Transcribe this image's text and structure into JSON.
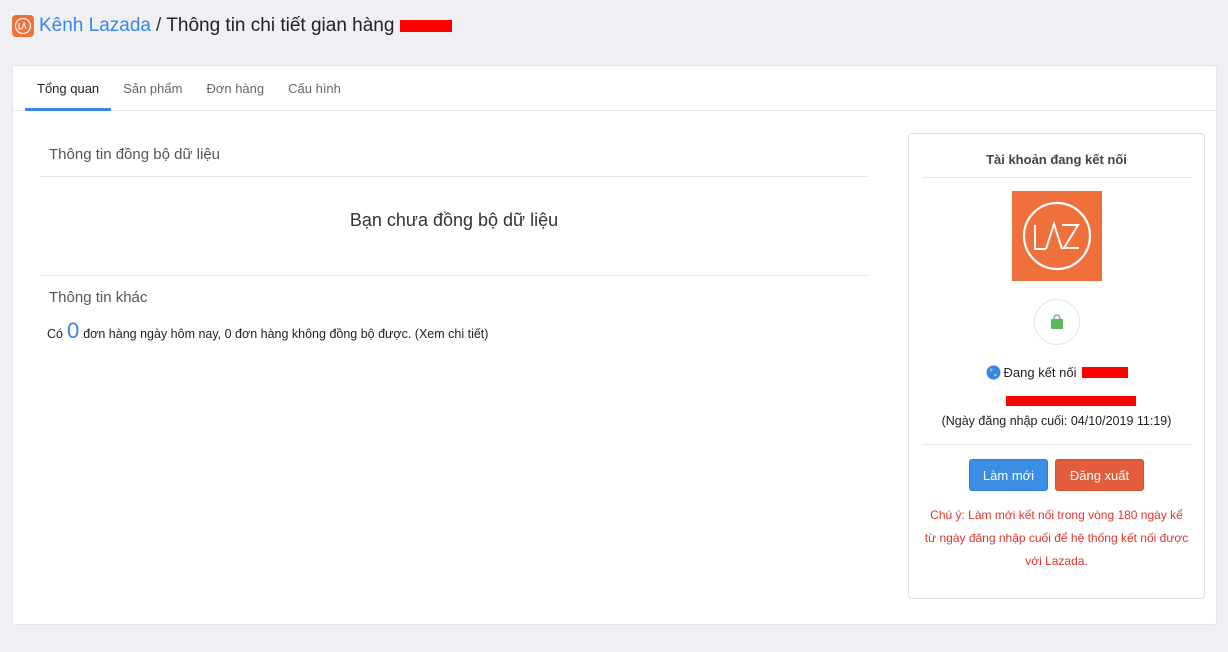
{
  "header": {
    "breadcrumb_link": "Kênh Lazada",
    "separator": "/",
    "title": "Thông tin chi tiết gian hàng"
  },
  "tabs": [
    {
      "label": "Tổng quan",
      "active": true
    },
    {
      "label": "Sản phẩm",
      "active": false
    },
    {
      "label": "Đơn hàng",
      "active": false
    },
    {
      "label": "Cấu hình",
      "active": false
    }
  ],
  "sync": {
    "section_title": "Thông tin đồng bộ dữ liệu",
    "message": "Bạn chưa đồng bộ dữ liệu"
  },
  "other": {
    "section_title": "Thông tin khác",
    "prefix": "Có",
    "orders_today": "0",
    "suffix": "đơn hàng ngày hôm nay, 0 đơn hàng không đồng bộ được. (Xem chi tiết)"
  },
  "account": {
    "title": "Tài khoản đang kết nối",
    "logo_text": "LAZ",
    "connected_label": "Đang kết nối",
    "last_login": "(Ngày đăng nhập cuối: 04/10/2019 11:19)",
    "refresh_button": "Làm mới",
    "logout_button": "Đăng xuất",
    "note": "Chú ý: Làm mới kết nối trong vòng 180 ngày kể từ ngày đăng nhập cuối để hệ thống kết nối được với Lazada."
  },
  "colors": {
    "accent": "#3a86e8",
    "brand": "#f0703b",
    "danger": "#e35c3e",
    "warning_text": "#e2342a"
  }
}
